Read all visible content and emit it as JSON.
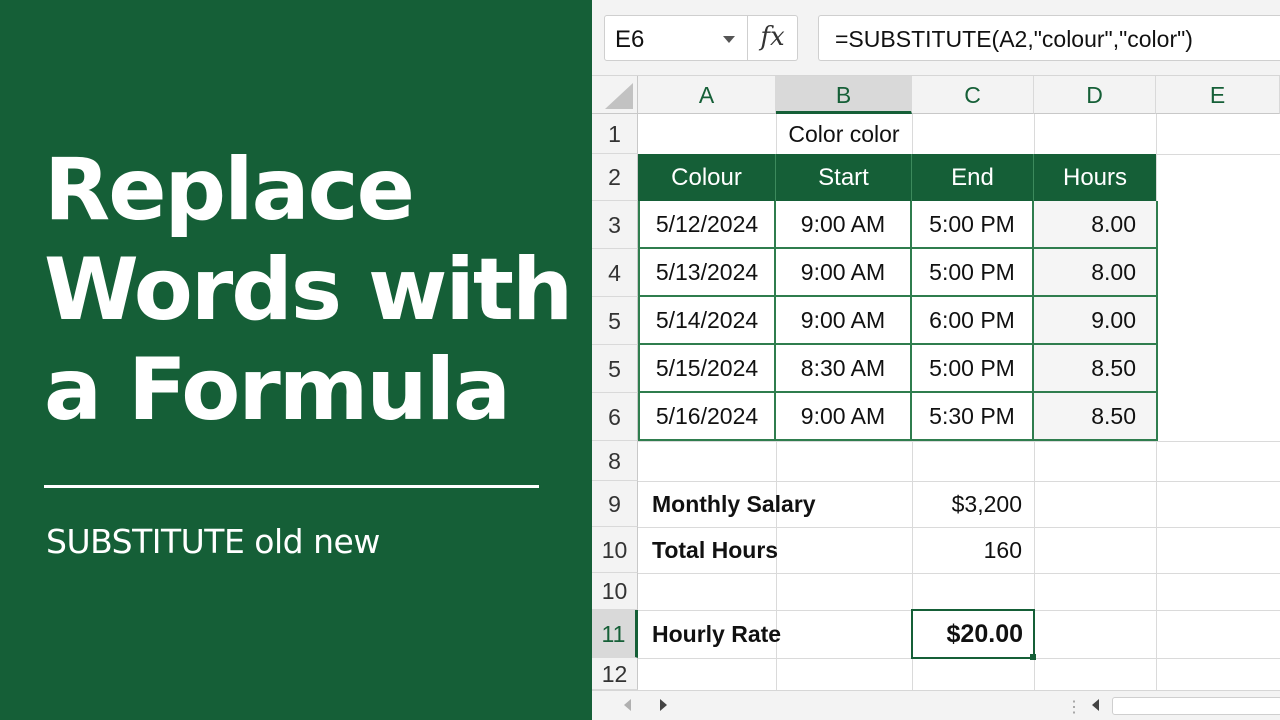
{
  "title_lines": [
    "Replace",
    "Words with",
    "a Formula"
  ],
  "subtitle": "SUBSTITUTE old new",
  "name_box": "E6",
  "fx_label": "fx",
  "formula": "=SUBSTITUTE(A2,\"colour\",\"color\")",
  "columns": [
    "A",
    "B",
    "C",
    "D",
    "E"
  ],
  "rows": [
    "1",
    "2",
    "3",
    "4",
    "5",
    "5",
    "6",
    "8",
    "9",
    "10",
    "10",
    "11",
    "12"
  ],
  "cells": {
    "b1": "Color color",
    "headers": [
      "Colour",
      "Start",
      "End",
      "Hours"
    ],
    "table": [
      [
        "5/12/2024",
        "9:00 AM",
        "5:00 PM",
        "8.00"
      ],
      [
        "5/13/2024",
        "9:00 AM",
        "5:00 PM",
        "8.00"
      ],
      [
        "5/14/2024",
        "9:00 AM",
        "6:00 PM",
        "9.00"
      ],
      [
        "5/15/2024",
        "8:30 AM",
        "5:00 PM",
        "8.50"
      ],
      [
        "5/16/2024",
        "9:00 AM",
        "5:30 PM",
        "8.50"
      ]
    ],
    "monthly_salary_label": "Monthly Salary",
    "monthly_salary_value": "$3,200",
    "total_hours_label": "Total Hours",
    "total_hours_value": "160",
    "hourly_rate_label": "Hourly Rate",
    "hourly_rate_value": "$20.00"
  },
  "scroll_handle": "⋮",
  "colors": {
    "brand_green": "#155f37",
    "table_border": "#2f7d4e"
  }
}
